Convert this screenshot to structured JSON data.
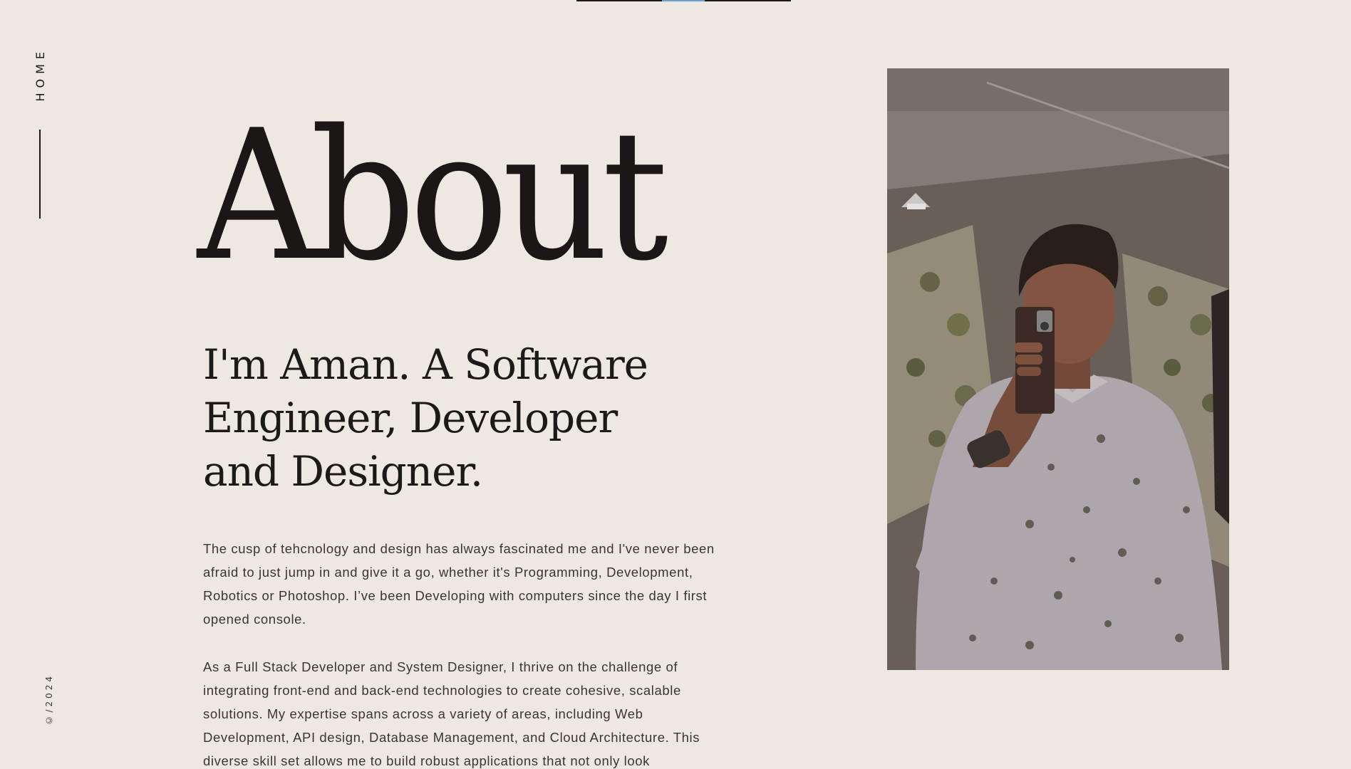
{
  "nav": {
    "home_label": "HOME",
    "copyright": "©/2024"
  },
  "about": {
    "title": "About",
    "intro": "I'm Aman. A Software Engineer, Developer and Designer.",
    "paragraphs": [
      "The cusp of tehcnology and design has always fascinated me and I've never been afraid to just jump in and give it a go, whether it's Programming, Development, Robotics or Photoshop. I’ve been Developing with computers since the day I first opened console.",
      "As a Full Stack Developer and System Designer, I thrive on the challenge of integrating front-end and back-end technologies to create cohesive, scalable solutions. My expertise spans across a variety of areas, including Web Development, API design, Database Management, and Cloud Architecture. This diverse skill set allows me to build robust applications that not only look"
    ]
  },
  "colors": {
    "background": "#ede8e1",
    "text": "#1c1a19",
    "body_text": "#3a3633",
    "accent": "#6b9fd4"
  }
}
